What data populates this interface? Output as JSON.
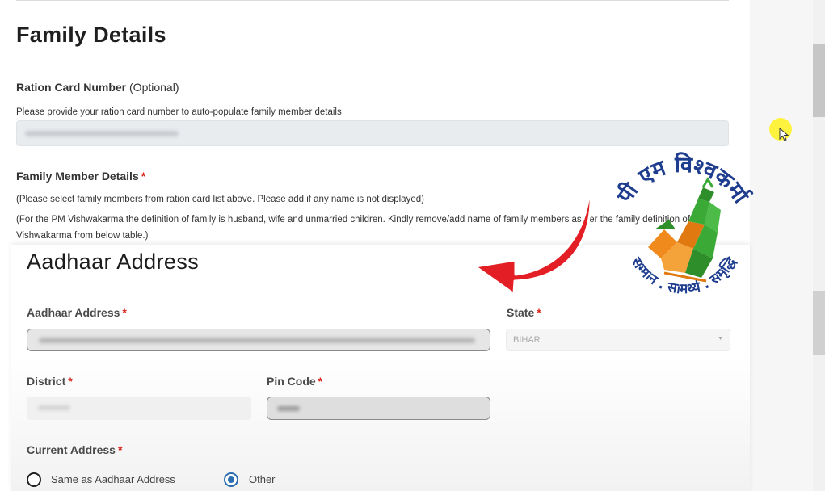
{
  "family": {
    "title": "Family Details",
    "ration_label": "Ration Card Number",
    "ration_optional": "(Optional)",
    "ration_help": "Please provide your ration card number to auto-populate family member details",
    "member_label": "Family Member Details",
    "member_note1": "(Please select family members from ration card list above. Please add if any name is not displayed)",
    "member_note2": "(For the PM Vishwakarma the definition of family is husband, wife and unmarried children. Kindly remove/add name of family members as per the family definition of PM Vishwakarma from below table.)",
    "required_mark": "*"
  },
  "aadhaar": {
    "title": "Aadhaar Address",
    "address_label": "Aadhaar Address",
    "state_label": "State",
    "state_value": "BIHAR",
    "district_label": "District",
    "pin_label": "Pin Code",
    "current_label": "Current Address",
    "option_same": "Same as Aadhaar Address",
    "option_other": "Other",
    "selected_option": "Other"
  },
  "logo": {
    "top_text": "पी एम विश्वकर्मा",
    "bottom_text": "सम्मान . सामर्थ्य . समृद्धि"
  },
  "colors": {
    "required": "#d9251c",
    "radio_selected": "#2b6fb2",
    "arrow": "#e31e24",
    "logo_blue": "#1f3d8f",
    "logo_orange": "#f08a1c",
    "logo_green": "#3aa935"
  }
}
